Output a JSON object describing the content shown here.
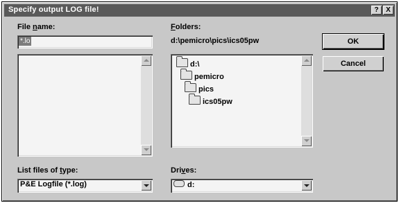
{
  "window": {
    "title": "Specify output LOG file!",
    "help_button": "?",
    "close_button": "X"
  },
  "file_name": {
    "label_pre": "File ",
    "label_ul": "n",
    "label_post": "ame:",
    "value": "*.lo"
  },
  "folders": {
    "label_pre": "",
    "label_ul": "F",
    "label_post": "olders:",
    "current_path": "d:\\pemicro\\pics\\ics05pw",
    "items": [
      "d:\\",
      "pemicro",
      "pics",
      "ics05pw"
    ]
  },
  "file_type": {
    "label_pre": "List files of ",
    "label_ul": "t",
    "label_post": "ype:",
    "selected": "P&E Logfile (*.log)"
  },
  "drives": {
    "label_pre": "Dri",
    "label_ul": "v",
    "label_post": "es:",
    "selected": "d:"
  },
  "buttons": {
    "ok": "OK",
    "cancel": "Cancel"
  },
  "icons": {
    "folder": "folder-icon",
    "drive": "drive-icon",
    "scroll_up": "arrow-up-icon",
    "scroll_down": "arrow-down-icon",
    "dropdown": "chevron-down-icon"
  }
}
